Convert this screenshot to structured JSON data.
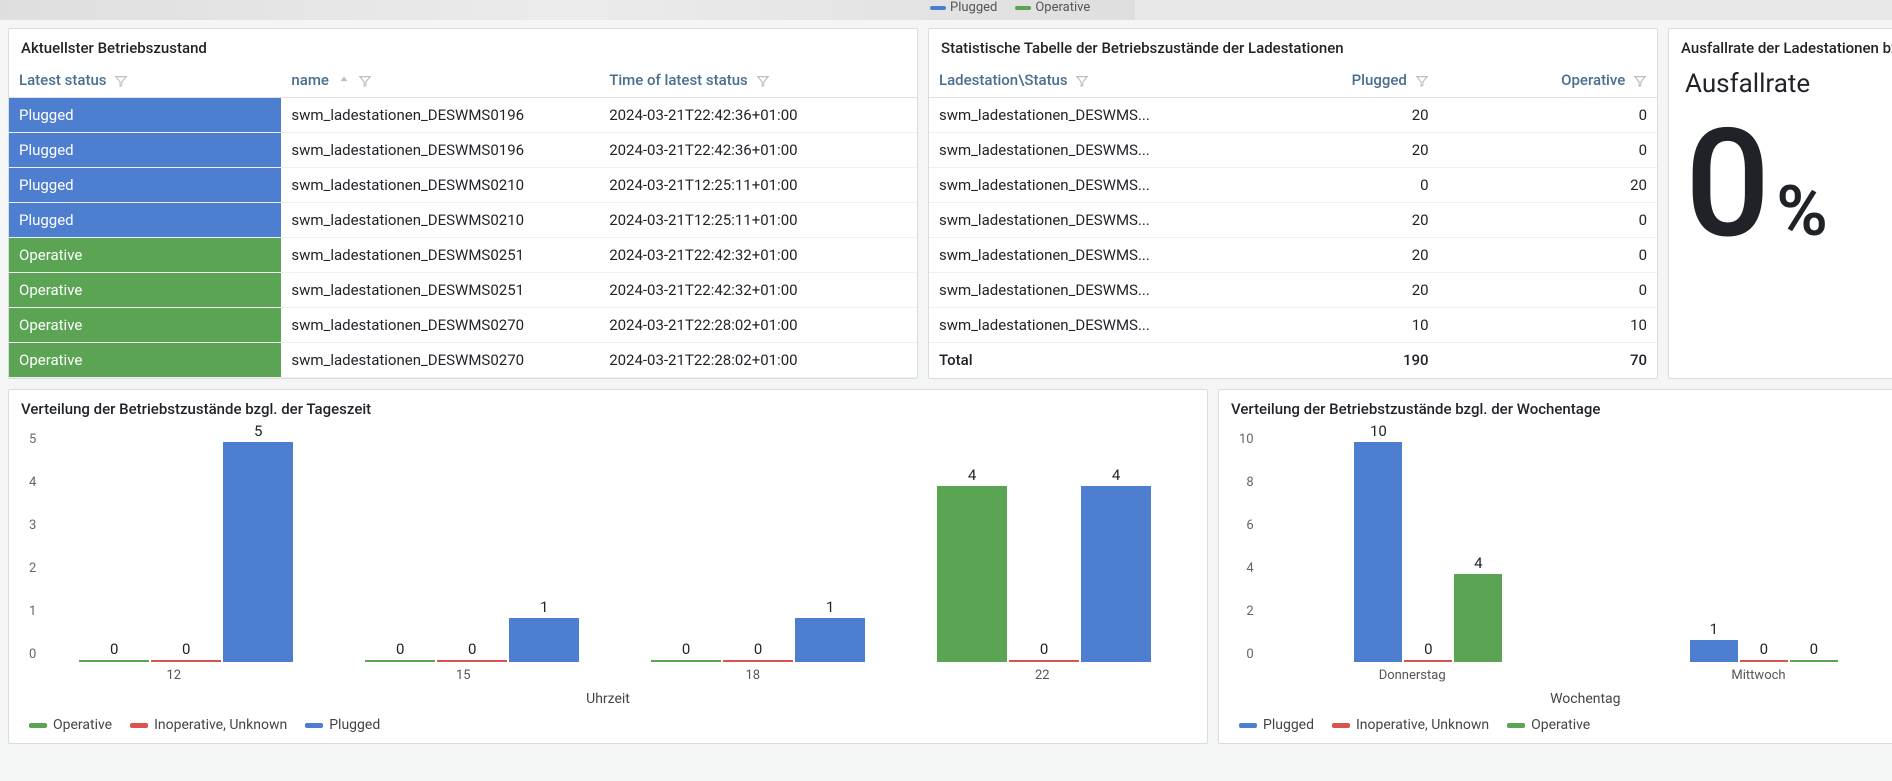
{
  "topLegend": {
    "plugged": "Plugged",
    "operative": "Operative"
  },
  "panel_status": {
    "title": "Aktuellster Betriebszustand",
    "columns": {
      "status": "Latest status",
      "name": "name",
      "time": "Time of latest status"
    },
    "rows": [
      {
        "status": "Plugged",
        "status_class": "status-plugged",
        "name": "swm_ladestationen_DESWMS0196",
        "time": "2024-03-21T22:42:36+01:00"
      },
      {
        "status": "Plugged",
        "status_class": "status-plugged",
        "name": "swm_ladestationen_DESWMS0196",
        "time": "2024-03-21T22:42:36+01:00"
      },
      {
        "status": "Plugged",
        "status_class": "status-plugged",
        "name": "swm_ladestationen_DESWMS0210",
        "time": "2024-03-21T12:25:11+01:00"
      },
      {
        "status": "Plugged",
        "status_class": "status-plugged",
        "name": "swm_ladestationen_DESWMS0210",
        "time": "2024-03-21T12:25:11+01:00"
      },
      {
        "status": "Operative",
        "status_class": "status-operative",
        "name": "swm_ladestationen_DESWMS0251",
        "time": "2024-03-21T22:42:32+01:00"
      },
      {
        "status": "Operative",
        "status_class": "status-operative",
        "name": "swm_ladestationen_DESWMS0251",
        "time": "2024-03-21T22:42:32+01:00"
      },
      {
        "status": "Operative",
        "status_class": "status-operative",
        "name": "swm_ladestationen_DESWMS0270",
        "time": "2024-03-21T22:28:02+01:00"
      },
      {
        "status": "Operative",
        "status_class": "status-operative",
        "name": "swm_ladestationen_DESWMS0270",
        "time": "2024-03-21T22:28:02+01:00"
      }
    ]
  },
  "panel_stats": {
    "title": "Statistische Tabelle der Betriebszustände der Ladestationen",
    "columns": {
      "station": "Ladestation\\Status",
      "plugged": "Plugged",
      "operative": "Operative"
    },
    "rows": [
      {
        "station": "swm_ladestationen_DESWMS...",
        "plugged": 20,
        "operative": 0
      },
      {
        "station": "swm_ladestationen_DESWMS...",
        "plugged": 20,
        "operative": 0
      },
      {
        "station": "swm_ladestationen_DESWMS...",
        "plugged": 0,
        "operative": 20
      },
      {
        "station": "swm_ladestationen_DESWMS...",
        "plugged": 20,
        "operative": 0
      },
      {
        "station": "swm_ladestationen_DESWMS...",
        "plugged": 20,
        "operative": 0
      },
      {
        "station": "swm_ladestationen_DESWMS...",
        "plugged": 20,
        "operative": 0
      },
      {
        "station": "swm_ladestationen_DESWMS...",
        "plugged": 10,
        "operative": 10
      }
    ],
    "total_label": "Total",
    "total_plugged": 190,
    "total_operative": 70
  },
  "panel_failrate": {
    "title": "Ausfallrate der Ladestationen bzlg. b...",
    "label": "Ausfallrate",
    "value": "0",
    "unit": "%"
  },
  "panel_hour": {
    "title": "Verteilung der Betriebstzustände bzgl. der Tageszeit",
    "xlabel": "Uhrzeit"
  },
  "panel_weekday": {
    "title": "Verteilung der Betriebstzustände bzgl. der Wochentage",
    "xlabel": "Wochentag"
  },
  "legend_series": {
    "operative": "Operative",
    "inop": "Inoperative, Unknown",
    "plugged": "Plugged"
  },
  "chart_data": [
    {
      "id": "hour",
      "type": "bar",
      "title": "Verteilung der Betriebstzustände bzgl. der Tageszeit",
      "xlabel": "Uhrzeit",
      "ylabel": "",
      "ylim": [
        0,
        5
      ],
      "yticks": [
        0,
        1,
        2,
        3,
        4,
        5
      ],
      "categories": [
        "12",
        "15",
        "18",
        "22"
      ],
      "series": [
        {
          "name": "Operative",
          "color": "#5aa454",
          "values": [
            0,
            0,
            0,
            4
          ]
        },
        {
          "name": "Inoperative, Unknown",
          "color": "#d9534f",
          "values": [
            0,
            0,
            0,
            0
          ]
        },
        {
          "name": "Plugged",
          "color": "#4d7ecf",
          "values": [
            5,
            1,
            1,
            4
          ]
        }
      ]
    },
    {
      "id": "weekday",
      "type": "bar",
      "title": "Verteilung der Betriebstzustände bzgl. der Wochentage",
      "xlabel": "Wochentag",
      "ylabel": "",
      "ylim": [
        0,
        10
      ],
      "yticks": [
        0,
        2,
        4,
        6,
        8,
        10
      ],
      "categories": [
        "Donnerstag",
        "Mittwoch"
      ],
      "series": [
        {
          "name": "Plugged",
          "color": "#4d7ecf",
          "values": [
            10,
            1
          ]
        },
        {
          "name": "Inoperative, Unknown",
          "color": "#d9534f",
          "values": [
            0,
            0
          ]
        },
        {
          "name": "Operative",
          "color": "#5aa454",
          "values": [
            4,
            0
          ]
        }
      ]
    }
  ]
}
